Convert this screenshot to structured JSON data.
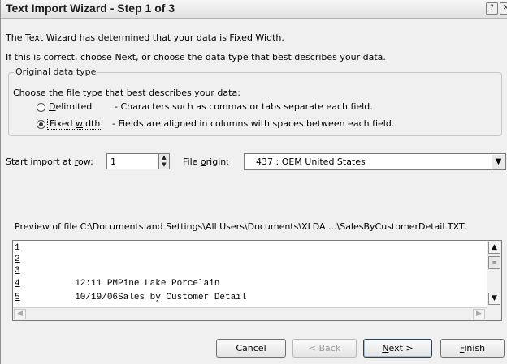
{
  "window": {
    "title": "Text Import Wizard - Step 1 of 3",
    "help_label": "?",
    "close_label": "✕"
  },
  "intro": {
    "line1": "The Text Wizard has determined that your data is Fixed Width.",
    "line2": "If this is correct, choose Next, or choose the data type that best describes your data."
  },
  "original_data_type": {
    "legend": "Original data type",
    "prompt": "Choose the file type that best describes your data:",
    "options": [
      {
        "label_mnemonic": "D",
        "label_rest": "elimited",
        "description": "- Characters such as commas or tabs separate each field.",
        "selected": false
      },
      {
        "label_prefix": "Fixed ",
        "label_mnemonic": "w",
        "label_rest": "idth",
        "description": "- Fields are aligned in columns with spaces between each field.",
        "selected": true
      }
    ]
  },
  "start_row": {
    "label_prefix": "Start import at ",
    "label_mnemonic": "r",
    "label_rest": "ow:",
    "value": "1"
  },
  "file_origin": {
    "label_prefix": "File ",
    "label_mnemonic": "o",
    "label_rest": "rigin:",
    "value": "437 : OEM United States"
  },
  "preview": {
    "label": "Preview of file C:\\Documents and Settings\\All Users\\Documents\\XLDA ...\\SalesByCustomerDetail.TXT.",
    "lines": [
      {
        "num": "1",
        "text": ""
      },
      {
        "num": "2",
        "text": ""
      },
      {
        "num": "3",
        "text": ""
      },
      {
        "num": "4",
        "text": "       12:11 PMPine Lake Porcelain"
      },
      {
        "num": "5",
        "text": "       10/19/06Sales by Customer Detail"
      }
    ]
  },
  "buttons": {
    "cancel": "Cancel",
    "back": "< Back",
    "next_mnemonic": "N",
    "next_rest": "ext >",
    "finish_mnemonic": "F",
    "finish_rest": "inish"
  }
}
